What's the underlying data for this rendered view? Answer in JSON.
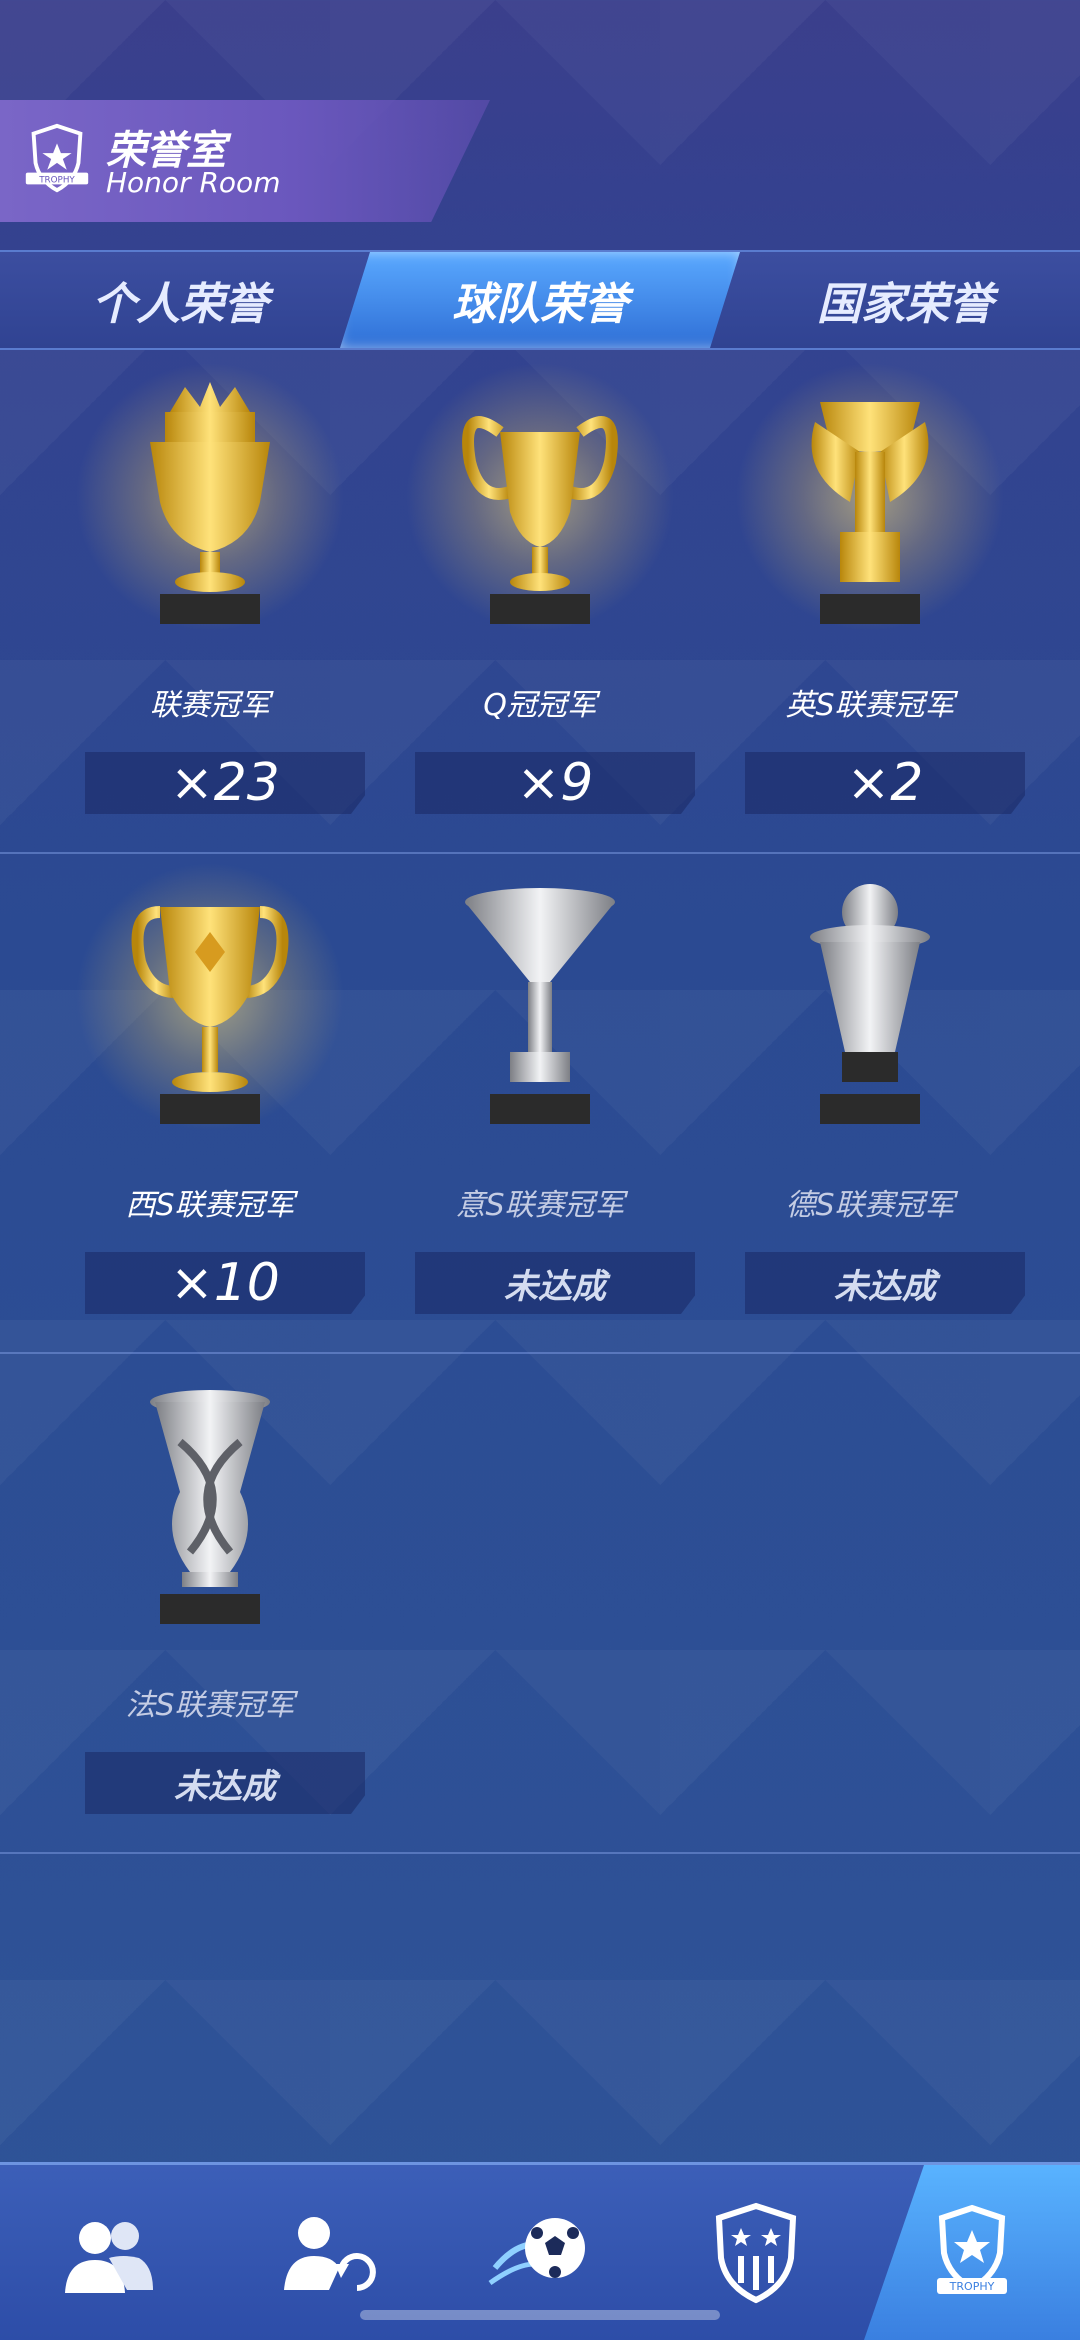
{
  "header": {
    "title": "荣誉室",
    "subtitle": "Honor Room",
    "icon_label": "TROPHY"
  },
  "tabs": [
    {
      "label": "个人荣誉",
      "active": false
    },
    {
      "label": "球队荣誉",
      "active": true
    },
    {
      "label": "国家荣誉",
      "active": false
    }
  ],
  "trophies": [
    {
      "name": "联赛冠军",
      "count": "×23",
      "achieved": true,
      "color": "gold",
      "icon": "crown-cup-icon"
    },
    {
      "name": "Q冠冠军",
      "count": "×9",
      "achieved": true,
      "color": "gold",
      "icon": "big-ears-cup-icon"
    },
    {
      "name": "英S联赛冠军",
      "count": "×2",
      "achieved": true,
      "color": "gold",
      "icon": "winged-cup-icon"
    },
    {
      "name": "西S联赛冠军",
      "count": "×10",
      "achieved": true,
      "color": "gold",
      "icon": "diamond-cup-icon"
    },
    {
      "name": "意S联赛冠军",
      "count": "未达成",
      "achieved": false,
      "color": "silver",
      "icon": "funnel-cup-icon"
    },
    {
      "name": "德S联赛冠军",
      "count": "未达成",
      "achieved": false,
      "color": "silver",
      "icon": "ball-cup-icon"
    },
    {
      "name": "法S联赛冠军",
      "count": "未达成",
      "achieved": false,
      "color": "silver",
      "icon": "twisted-cup-icon"
    }
  ],
  "bottom_nav": [
    {
      "name": "squad-nav",
      "icon": "players-icon",
      "active": false
    },
    {
      "name": "transfer-nav",
      "icon": "player-swap-icon",
      "active": false
    },
    {
      "name": "match-nav",
      "icon": "football-icon",
      "active": false
    },
    {
      "name": "club-nav",
      "icon": "club-crest-icon",
      "active": false
    },
    {
      "name": "trophy-nav",
      "icon": "trophy-icon",
      "active": true,
      "label": "TROPHY"
    }
  ],
  "colors": {
    "gold": "#f2c64a",
    "silver": "#c8ccd4",
    "active_tab": "#3d8ce8",
    "background": "#2f4a94"
  }
}
